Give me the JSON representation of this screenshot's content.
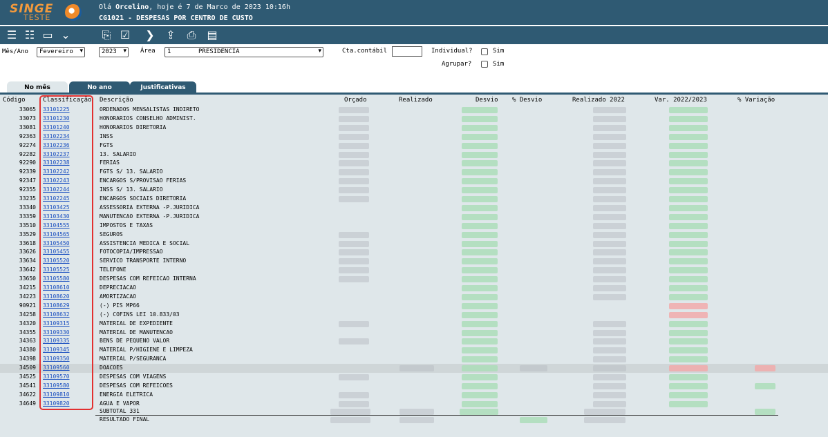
{
  "header": {
    "logo_text": "SINGE",
    "logo_sub": "TESTE",
    "greeting_prefix": "Olá ",
    "user": "Orcelino",
    "greeting_suffix": ", hoje é 7 de Marco de 2023 10:16h",
    "subtitle": "CG1021 - DESPESAS POR CENTRO DE CUSTO"
  },
  "toolbar": {
    "icons": [
      "list-icon",
      "list-alt-icon",
      "screen-icon",
      "collapse-icon",
      "book-icon",
      "checklist-icon",
      "next-icon",
      "export-icon",
      "print-icon",
      "document-icon"
    ]
  },
  "filters": {
    "mes_label": "Mês/Ano",
    "mes_value": "Fevereiro",
    "ano_value": "2023",
    "area_label": "Área",
    "area_code": "1",
    "area_value": "PRESIDENCIA",
    "cta_label": "Cta.contábil",
    "cta_value": "",
    "individual_label": "Individual?",
    "individual_sim": "Sim",
    "agrupar_label": "Agrupar?",
    "agrupar_sim": "Sim"
  },
  "tabs": [
    "No mês",
    "No ano",
    "Justificativas"
  ],
  "columns": {
    "codigo": "Código",
    "classificacao": "Classificação",
    "descricao": "Descrição",
    "orcado": "Orçado",
    "realizado": "Realizado",
    "desvio": "Desvio",
    "pct_desvio": "% Desvio",
    "realizado_2022": "Realizado 2022",
    "var": "Var. 2022/2023",
    "pct_variacao": "% Variação"
  },
  "rows": [
    {
      "codigo": "33065",
      "classificacao": "33101225",
      "descricao": "ORDENADOS MENSALISTAS INDIRETO"
    },
    {
      "codigo": "33073",
      "classificacao": "33101230",
      "descricao": "HONORARIOS CONSELHO ADMINIST."
    },
    {
      "codigo": "33081",
      "classificacao": "33101240",
      "descricao": "HONORARIOS DIRETORIA"
    },
    {
      "codigo": "92363",
      "classificacao": "33102234",
      "descricao": "INSS"
    },
    {
      "codigo": "92274",
      "classificacao": "33102236",
      "descricao": "FGTS"
    },
    {
      "codigo": "92282",
      "classificacao": "33102237",
      "descricao": "13. SALARIO"
    },
    {
      "codigo": "92290",
      "classificacao": "33102238",
      "descricao": "FERIAS"
    },
    {
      "codigo": "92339",
      "classificacao": "33102242",
      "descricao": "FGTS S/ 13. SALARIO"
    },
    {
      "codigo": "92347",
      "classificacao": "33102243",
      "descricao": "ENCARGOS S/PROVISAO FERIAS"
    },
    {
      "codigo": "92355",
      "classificacao": "33102244",
      "descricao": "INSS S/ 13. SALARIO"
    },
    {
      "codigo": "33235",
      "classificacao": "33102245",
      "descricao": "ENCARGOS SOCIAIS DIRETORIA"
    },
    {
      "codigo": "33340",
      "classificacao": "33103425",
      "descricao": "ASSESSORIA EXTERNA -P.JURIDICA"
    },
    {
      "codigo": "33359",
      "classificacao": "33103430",
      "descricao": "MANUTENCAO EXTERNA -P.JURIDICA"
    },
    {
      "codigo": "33510",
      "classificacao": "33104555",
      "descricao": "IMPOSTOS E TAXAS"
    },
    {
      "codigo": "33529",
      "classificacao": "33104565",
      "descricao": "SEGUROS"
    },
    {
      "codigo": "33618",
      "classificacao": "33105450",
      "descricao": "ASSISTENCIA MEDICA E SOCIAL"
    },
    {
      "codigo": "33626",
      "classificacao": "33105455",
      "descricao": "FOTOCOPIA/IMPRESSAO"
    },
    {
      "codigo": "33634",
      "classificacao": "33105520",
      "descricao": "SERVICO TRANSPORTE INTERNO"
    },
    {
      "codigo": "33642",
      "classificacao": "33105525",
      "descricao": "TELEFONE"
    },
    {
      "codigo": "33650",
      "classificacao": "33105580",
      "descricao": "DESPESAS COM REFEICAO INTERNA"
    },
    {
      "codigo": "34215",
      "classificacao": "33108610",
      "descricao": "DEPRECIACAO"
    },
    {
      "codigo": "34223",
      "classificacao": "33108620",
      "descricao": "AMORTIZACAO"
    },
    {
      "codigo": "90921",
      "classificacao": "33108629",
      "descricao": "(-) PIS MP66"
    },
    {
      "codigo": "34258",
      "classificacao": "33108632",
      "descricao": "(-) COFINS LEI 10.833/03"
    },
    {
      "codigo": "34320",
      "classificacao": "33109315",
      "descricao": "MATERIAL DE EXPEDIENTE"
    },
    {
      "codigo": "34355",
      "classificacao": "33109330",
      "descricao": "MATERIAL DE MANUTENCAO"
    },
    {
      "codigo": "34363",
      "classificacao": "33109335",
      "descricao": "BENS DE PEQUENO VALOR"
    },
    {
      "codigo": "34380",
      "classificacao": "33109345",
      "descricao": "MATERIAL P/HIGIENE E LIMPEZA"
    },
    {
      "codigo": "34398",
      "classificacao": "33109350",
      "descricao": "MATERIAL P/SEGURANCA"
    },
    {
      "codigo": "34509",
      "classificacao": "33109560",
      "descricao": "DOACOES"
    },
    {
      "codigo": "34525",
      "classificacao": "33109570",
      "descricao": "DESPESAS COM VIAGENS"
    },
    {
      "codigo": "34541",
      "classificacao": "33109580",
      "descricao": "DESPESAS COM REFEICOES"
    },
    {
      "codigo": "34622",
      "classificacao": "33109810",
      "descricao": "ENERGIA ELETRICA"
    },
    {
      "codigo": "34649",
      "classificacao": "33109820",
      "descricao": "AGUA E VAPOR"
    }
  ],
  "subtotal_label": "SUBTOTAL 331",
  "total_label": "RESULTADO FINAL",
  "colors": {
    "header_bg": "#2f5a73",
    "logo_orange": "#f39a3c",
    "panel_bg": "#dfe7ea",
    "link_blue": "#1a4fc0",
    "highlight_red": "#e23030"
  }
}
